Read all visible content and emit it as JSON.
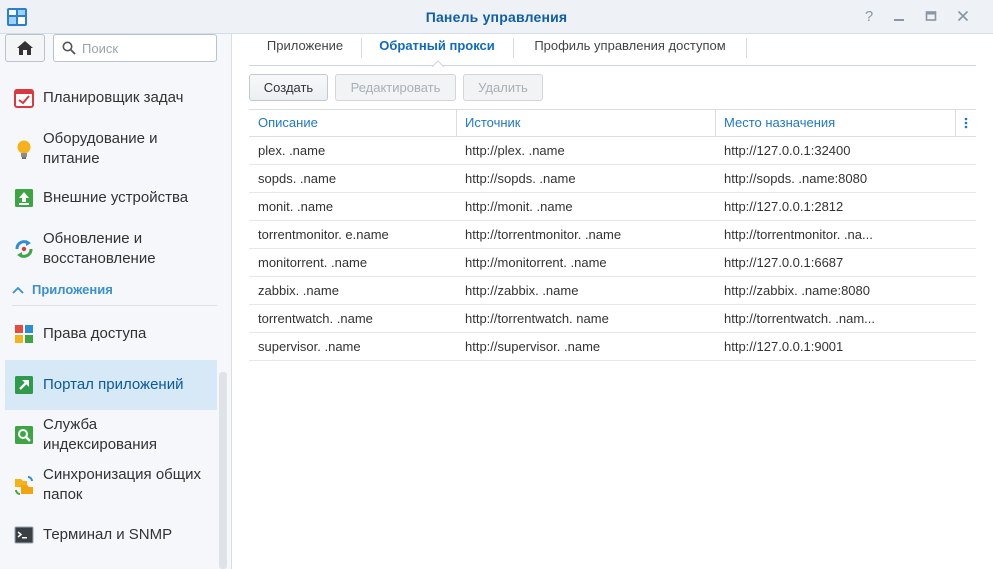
{
  "window": {
    "title": "Панель управления",
    "buttons": [
      "help-icon",
      "minimize-icon",
      "maximize-icon",
      "close-icon"
    ]
  },
  "sidebar": {
    "search_placeholder": "Поиск",
    "items_top": [
      {
        "label": "Планировщик задач",
        "icon": "calendar-check-icon"
      },
      {
        "label": "Оборудование и\nпитание",
        "icon": "lightbulb-icon"
      },
      {
        "label": "Внешние устройства",
        "icon": "upload-arrow-icon"
      },
      {
        "label": "Обновление и\nвосстановление",
        "icon": "update-arrows-icon"
      }
    ],
    "section_label": "Приложения",
    "items_apps": [
      {
        "label": "Права доступа",
        "icon": "app-grid-icon"
      },
      {
        "label": "Портал приложений",
        "icon": "portal-arrow-icon",
        "active": true
      },
      {
        "label": "Служба\nиндексирования",
        "icon": "magnifier-icon"
      },
      {
        "label": "Синхронизация общих\nпапок",
        "icon": "folder-sync-icon"
      },
      {
        "label": "Терминал и SNMP",
        "icon": "terminal-icon"
      }
    ]
  },
  "tabs": [
    {
      "label": "Приложение"
    },
    {
      "label": "Обратный прокси",
      "active": true
    },
    {
      "label": "Профиль управления доступом"
    }
  ],
  "toolbar": {
    "create": "Создать",
    "edit": "Редактировать",
    "delete": "Удалить"
  },
  "table": {
    "columns": [
      "Описание",
      "Источник",
      "Место назначения"
    ],
    "rows": [
      [
        "plex.           .name",
        "http://plex.                .name",
        "http://127.0.0.1:32400"
      ],
      [
        "sopds.             .name",
        "http://sopds.              .name",
        "http://sopds.              .name:8080"
      ],
      [
        "monit.          .name",
        "http://monit.               .name",
        "http://127.0.0.1:2812"
      ],
      [
        "torrentmonitor.       e.name",
        "http://torrentmonitor.             .name",
        "http://torrentmonitor.            .na..."
      ],
      [
        "monitorrent.              .name",
        "http://monitorrent.              .name",
        "http://127.0.0.1:6687"
      ],
      [
        "zabbix.              .name",
        "http://zabbix.               .name",
        "http://zabbix.              .name:8080"
      ],
      [
        "torrentwatch.              .name",
        "http://torrentwatch.              name",
        "http://torrentwatch.             .nam..."
      ],
      [
        "supervisor.              .name",
        "http://supervisor.              .name",
        "http://127.0.0.1:9001"
      ]
    ]
  },
  "colors": {
    "accent": "#1f78c8",
    "title": "#0e5ea8",
    "active_bg": "#d7e8f6"
  }
}
